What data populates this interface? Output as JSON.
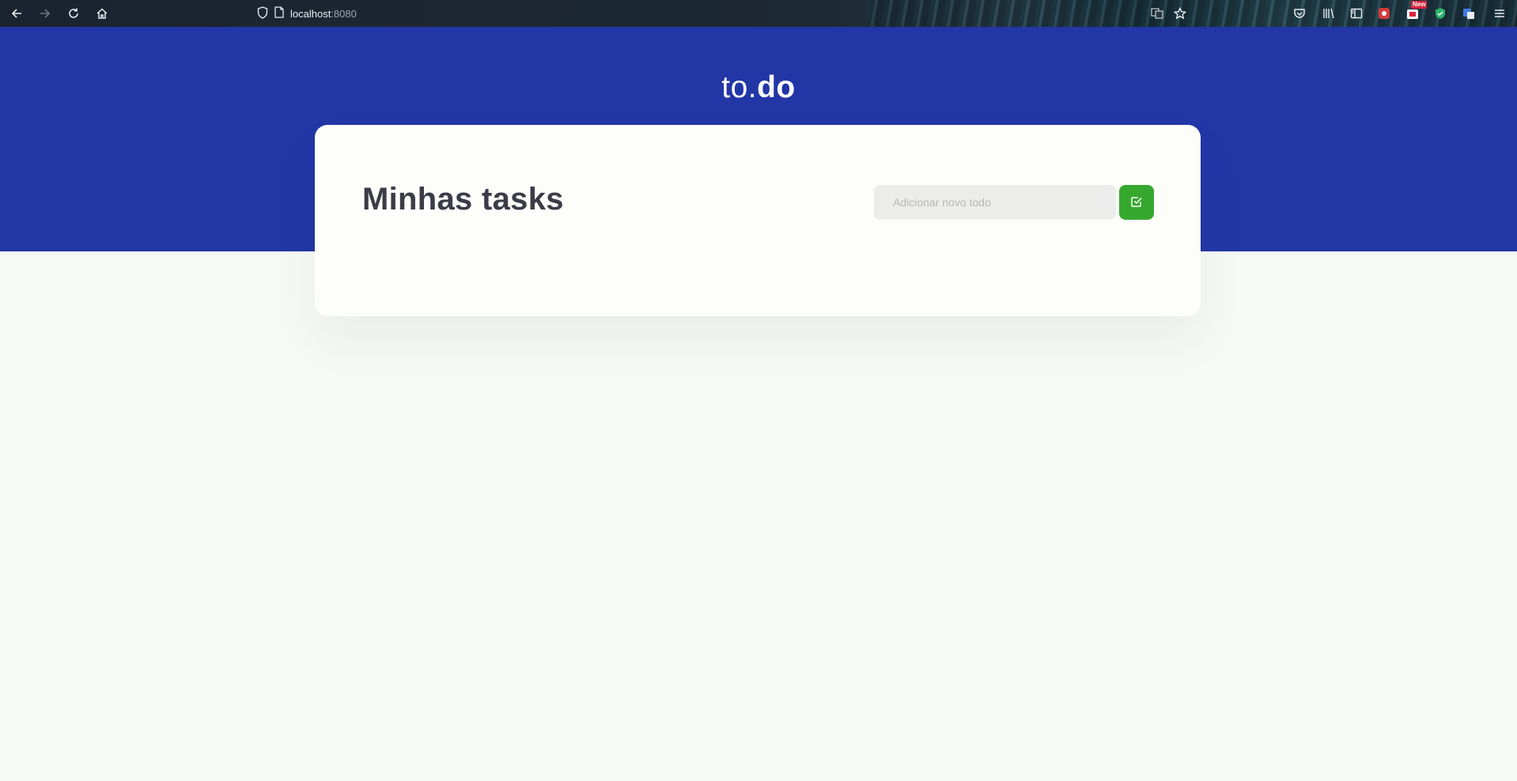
{
  "browser": {
    "url_host": "localhost",
    "url_port": ":8080",
    "new_badge": "New",
    "icons": [
      "back-icon",
      "forward-icon",
      "reload-icon",
      "home-icon",
      "shield-icon",
      "page-icon",
      "translate-icon",
      "bookmark-star-icon",
      "pocket-icon",
      "library-icon",
      "sidebar-icon",
      "extension-icon",
      "extension-new-icon",
      "vpn-shield-icon",
      "translator-icon",
      "menu-icon"
    ]
  },
  "header": {
    "logo_prefix": "to.",
    "logo_suffix": "do"
  },
  "card": {
    "title": "Minhas tasks",
    "input_placeholder": "Adicionar novo todo",
    "input_value": ""
  },
  "colors": {
    "hero": "#2236a6",
    "card": "#fdfdfa",
    "button": "#36a82e",
    "title": "#3c3c48",
    "page_bg": "#f7f9f5"
  }
}
